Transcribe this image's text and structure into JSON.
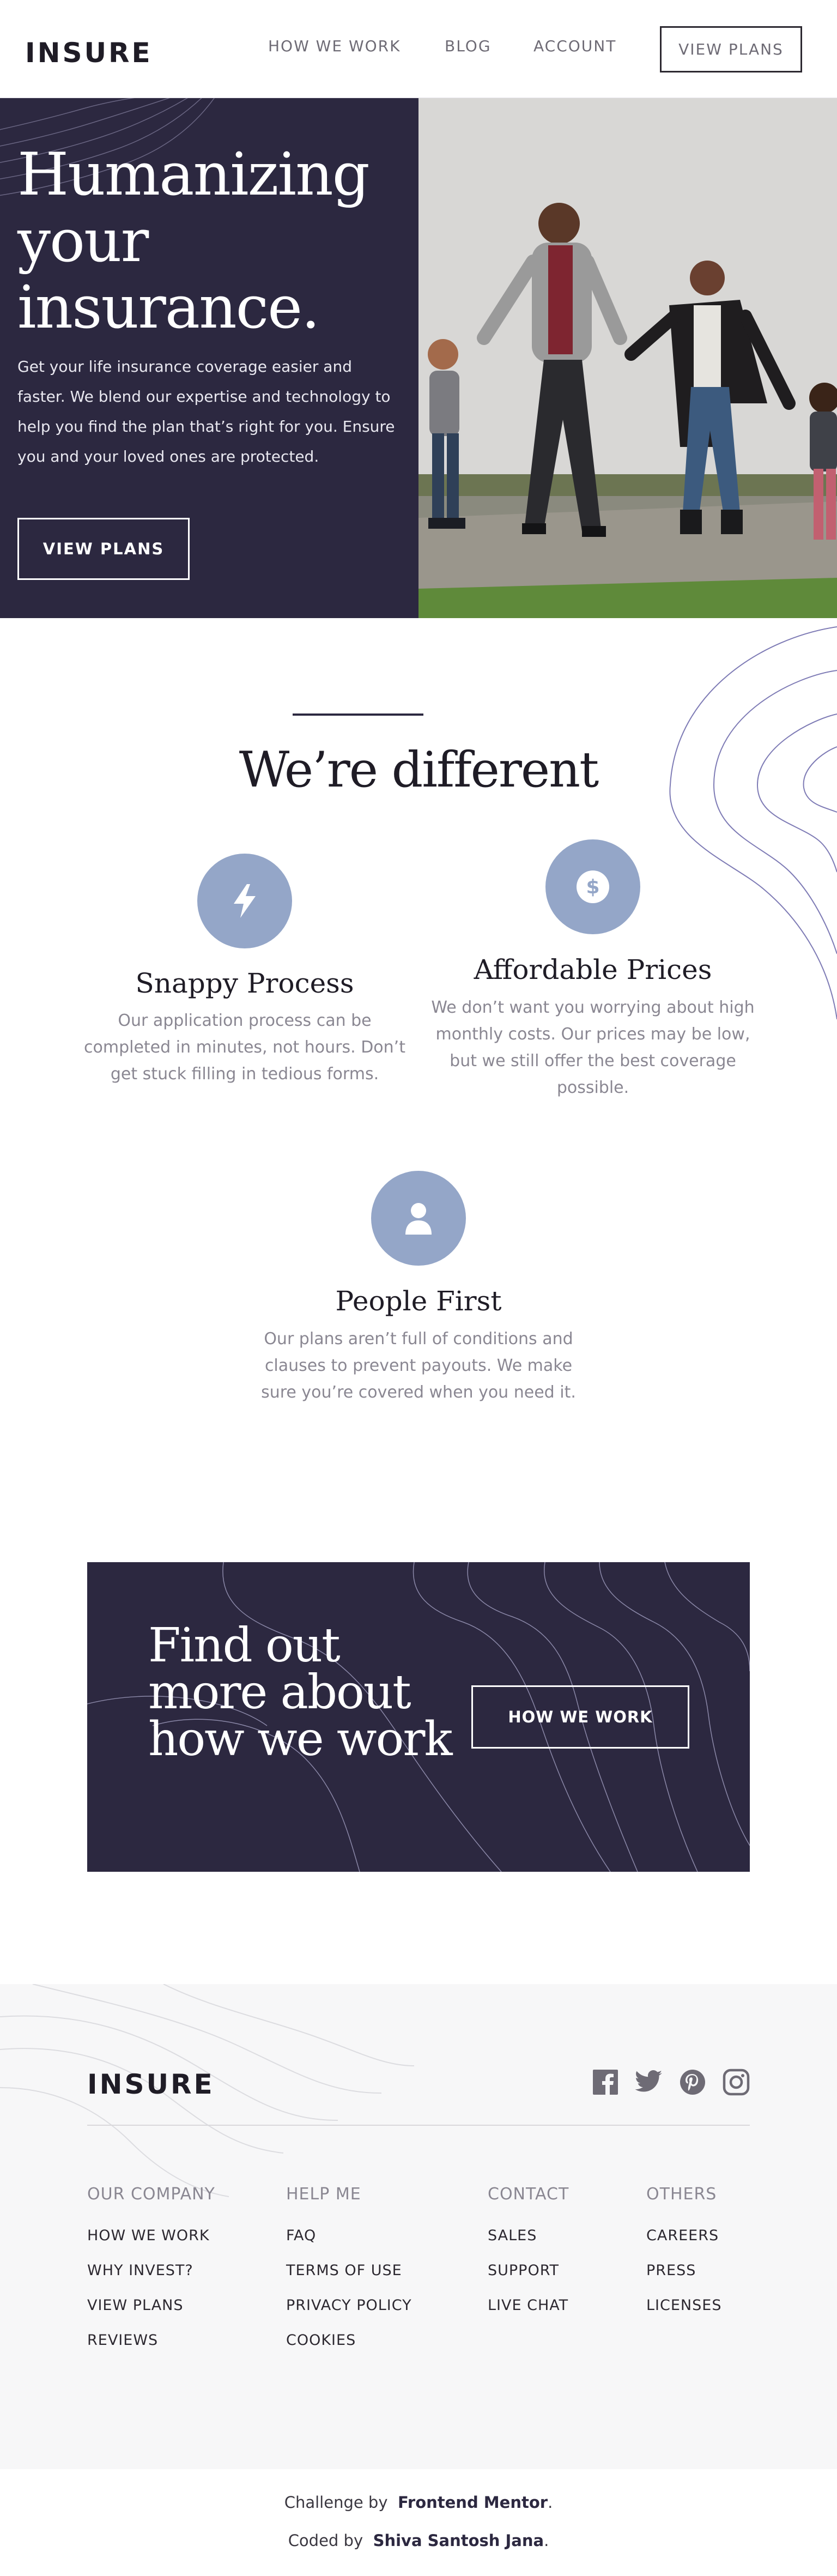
{
  "header": {
    "logo": "INSURE",
    "nav": [
      "HOW WE WORK",
      "BLOG",
      "ACCOUNT"
    ],
    "cta": "VIEW PLANS"
  },
  "hero": {
    "title": "Humanizing your insurance.",
    "text": "Get your life insurance coverage easier and faster. We blend our expertise and technology to help you find the plan that’s right for you. Ensure you and your loved ones are protected.",
    "button": "VIEW PLANS",
    "image_icon": "family-photo"
  },
  "different": {
    "title": "We’re different",
    "features": [
      {
        "icon": "lightning-icon",
        "title": "Snappy Process",
        "text": "Our application process can be completed in minutes, not hours. Don’t get stuck filling in tedious forms."
      },
      {
        "icon": "dollar-icon",
        "title": "Affordable Prices",
        "text": "We don’t want you worrying about high monthly costs. Our prices may be low, but we still offer the best coverage possible."
      },
      {
        "icon": "person-icon",
        "title": "People First",
        "text": "Our plans aren’t full of conditions and clauses to prevent payouts. We make sure you’re covered when you need it."
      }
    ]
  },
  "cta": {
    "title": "Find out more about how we work",
    "button": "HOW WE WORK"
  },
  "footer": {
    "logo": "INSURE",
    "social": [
      "facebook-icon",
      "twitter-icon",
      "pinterest-icon",
      "instagram-icon"
    ],
    "columns": [
      {
        "heading": "OUR COMPANY",
        "links": [
          "HOW WE WORK",
          "WHY INVEST?",
          "VIEW PLANS",
          "REVIEWS"
        ]
      },
      {
        "heading": "HELP ME",
        "links": [
          "FAQ",
          "TERMS OF USE",
          "PRIVACY POLICY",
          "COOKIES"
        ]
      },
      {
        "heading": "CONTACT",
        "links": [
          "SALES",
          "SUPPORT",
          "LIVE CHAT"
        ]
      },
      {
        "heading": "OTHERS",
        "links": [
          "CAREERS",
          "PRESS",
          "LICENSES"
        ]
      }
    ]
  },
  "credits": {
    "challenge_prefix": "Challenge by",
    "challenge_name": "Frontend Mentor",
    "coded_prefix": "Coded by",
    "coded_name": "Shiva Santosh Jana",
    "period": "."
  },
  "colors": {
    "dark_violet": "#2c2840",
    "light_blue": "#94a6c8",
    "footer_bg": "#f7f7f8"
  }
}
